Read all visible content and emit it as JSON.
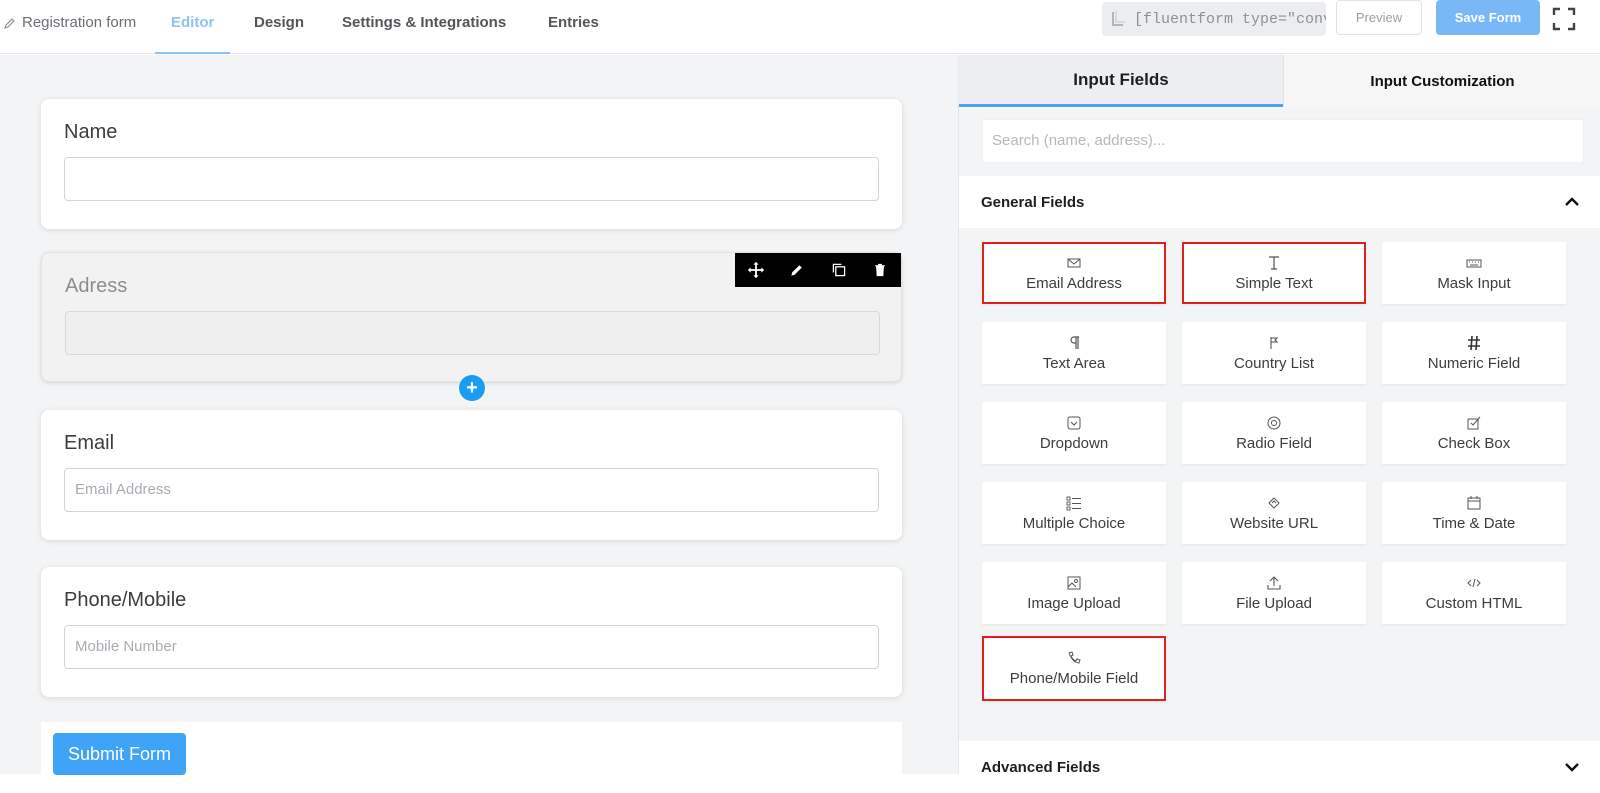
{
  "topbar": {
    "brand": "Registration form",
    "tabs": [
      "Editor",
      "Design",
      "Settings & Integrations",
      "Entries"
    ],
    "shortcode": "[fluentform type=\"conver",
    "preview_label": "Preview",
    "save_label": "Save Form"
  },
  "form": {
    "fields": [
      {
        "label": "Name",
        "placeholder": ""
      },
      {
        "label": "Adress",
        "placeholder": ""
      },
      {
        "label": "Email",
        "placeholder": "Email Address"
      },
      {
        "label": "Phone/Mobile",
        "placeholder": "Mobile Number"
      }
    ],
    "submit_label": "Submit Form",
    "add_symbol": "+"
  },
  "panel": {
    "tabs": [
      "Input Fields",
      "Input Customization"
    ],
    "search_placeholder": "Search (name, address)...",
    "general_title": "General Fields",
    "advanced_title": "Advanced Fields",
    "items": [
      {
        "label": "Email Address",
        "icon": "envelope-icon",
        "highlighted": true
      },
      {
        "label": "Simple Text",
        "icon": "text-cursor-icon",
        "highlighted": true
      },
      {
        "label": "Mask Input",
        "icon": "keyboard-icon",
        "highlighted": false
      },
      {
        "label": "Text Area",
        "icon": "paragraph-icon",
        "highlighted": false
      },
      {
        "label": "Country List",
        "icon": "flag-icon",
        "highlighted": false
      },
      {
        "label": "Numeric Field",
        "icon": "hash-icon",
        "highlighted": false
      },
      {
        "label": "Dropdown",
        "icon": "dropdown-icon",
        "highlighted": false
      },
      {
        "label": "Radio Field",
        "icon": "radio-icon",
        "highlighted": false
      },
      {
        "label": "Check Box",
        "icon": "checkbox-icon",
        "highlighted": false
      },
      {
        "label": "Multiple Choice",
        "icon": "list-icon",
        "highlighted": false
      },
      {
        "label": "Website URL",
        "icon": "link-icon",
        "highlighted": false
      },
      {
        "label": "Time & Date",
        "icon": "calendar-icon",
        "highlighted": false
      },
      {
        "label": "Image Upload",
        "icon": "image-icon",
        "highlighted": false
      },
      {
        "label": "File Upload",
        "icon": "upload-icon",
        "highlighted": false
      },
      {
        "label": "Custom HTML",
        "icon": "code-icon",
        "highlighted": false
      },
      {
        "label": "Phone/Mobile Field",
        "icon": "phone-icon",
        "highlighted": true
      }
    ]
  },
  "colors": {
    "accent": "#3fa3f7",
    "highlight_border": "#e0201c"
  }
}
